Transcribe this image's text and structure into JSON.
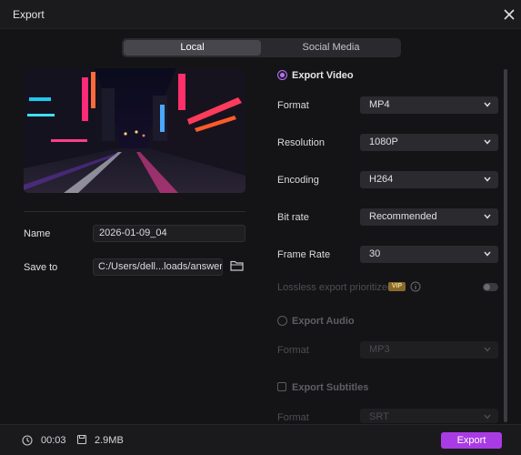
{
  "window": {
    "title": "Export"
  },
  "tabs": [
    {
      "label": "Local"
    },
    {
      "label": "Social Media"
    }
  ],
  "left": {
    "name_label": "Name",
    "name_value": "2026-01-09_04",
    "save_label": "Save to",
    "save_value": "C:/Users/dell...loads/answers"
  },
  "video": {
    "section": "Export Video",
    "rows": [
      {
        "label": "Format",
        "value": "MP4"
      },
      {
        "label": "Resolution",
        "value": "1080P"
      },
      {
        "label": "Encoding",
        "value": "H264"
      },
      {
        "label": "Bit rate",
        "value": "Recommended"
      },
      {
        "label": "Frame Rate",
        "value": "30"
      }
    ],
    "lossless_label": "Lossless export prioritized",
    "vip_badge": "VIP"
  },
  "audio": {
    "section": "Export Audio",
    "format_label": "Format",
    "format_value": "MP3"
  },
  "subtitles": {
    "section": "Export Subtitles",
    "format_label": "Format",
    "format_value": "SRT"
  },
  "footer": {
    "duration": "00:03",
    "size": "2.9MB",
    "export_label": "Export"
  },
  "colors": {
    "accent": "#a93be4",
    "radio": "#b872f7",
    "background": "#141416"
  },
  "icons": [
    "close-icon",
    "folder-icon",
    "info-icon",
    "clock-icon",
    "file-icon",
    "chevron-down-icon"
  ]
}
